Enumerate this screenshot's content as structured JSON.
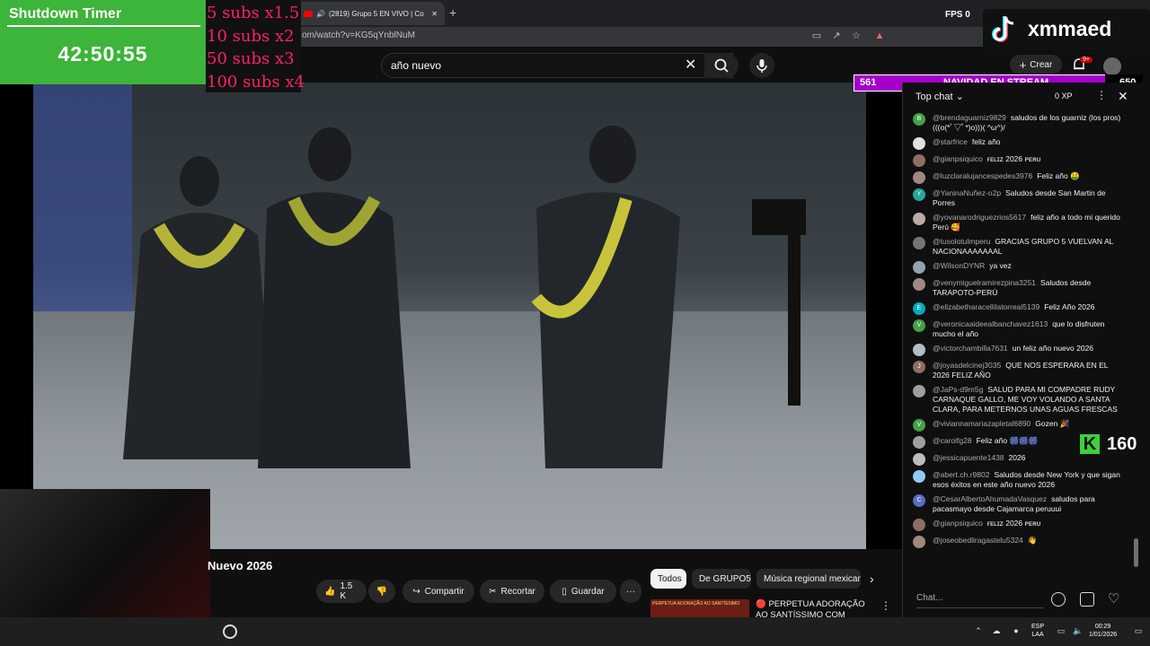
{
  "browser": {
    "tab_title": "(2819) Grupo 5 EN VIVO | Co",
    "new_tab": "+",
    "url": "om/watch?v=KG5qYnblNuM"
  },
  "fps_label": "FPS  0",
  "youtube": {
    "search_value": "año nuevo",
    "clear": "✕",
    "crear_label": "Crear",
    "notif_badge": "9+"
  },
  "overlay": {
    "shutdown_title": "Shutdown Timer",
    "shutdown_time": "42:50:55",
    "subs_lines": [
      "5 subs x1.5",
      "10 subs x2",
      "50 subs x3",
      "100 subs x4"
    ],
    "tiktok_name": "xmmaed",
    "nav_left": "561",
    "nav_mid": "NAVIDAD EN STREAM",
    "nav_right": "650",
    "k_letter": "K",
    "k_count": "160"
  },
  "video": {
    "title": "Nuevo 2026",
    "like_count": "1.5 K",
    "share_label": "Compartir",
    "clip_label": "Recortar",
    "save_label": "Guardar",
    "more_label": "···"
  },
  "chips": [
    "Todos",
    "De GRUPO5",
    "Música regional mexican"
  ],
  "recommendation": {
    "thumb_text": "PERPETUA ADORAÇÃO AO SANTÍSSIMO",
    "title": "🔴 PERPETUA ADORAÇÃO AO SANTÍSSIMO COM FREIRAS"
  },
  "chat": {
    "header": "Top chat",
    "xp": "0 XP",
    "close": "✕",
    "dots": "⋮",
    "input_placeholder": "Chat...",
    "messages": [
      {
        "initial": "B",
        "color": "#43a047",
        "author": "@brendaguarniz9829",
        "text": "saludos de los guarniz (los pros)(((o(*ﾟ▽ﾟ*)o)))( ^ω^)/"
      },
      {
        "initial": "",
        "color": "#e0e0e0",
        "author": "@starfrice",
        "text": "feliz año"
      },
      {
        "initial": "",
        "color": "#8d6e63",
        "author": "@gianpsiquico",
        "text": "ғᴇʟɪᴢ 2026 ᴘᴇʀᴜ"
      },
      {
        "initial": "",
        "color": "#a1887f",
        "author": "@luzclaralujancespedes3976",
        "text": "Feliz año 🤑"
      },
      {
        "initial": "Y",
        "color": "#26a69a",
        "author": "@YaninaNuñez-o2p",
        "text": "Saludos desde San Martin de Porres"
      },
      {
        "initial": "",
        "color": "#bcaaa4",
        "author": "@yovanarodriguezrios5617",
        "text": "feliz año a todo mi querido Perú 🥰"
      },
      {
        "initial": "",
        "color": "#757575",
        "author": "@tusolotulmperu",
        "text": "GRACIAS GRUPO 5 VUELVAN AL NACIONAAAAAAAL"
      },
      {
        "initial": "",
        "color": "#90a4ae",
        "author": "@WilsonDYNR",
        "text": "ya vez"
      },
      {
        "initial": "",
        "color": "#a1887f",
        "author": "@venymiguelramirezpina3251",
        "text": "Saludos desde TARAPOTO-PERÚ"
      },
      {
        "initial": "E",
        "color": "#00acc1",
        "author": "@elizabetharacellilatorreal5139",
        "text": "Feliz Año 2026"
      },
      {
        "initial": "V",
        "color": "#43a047",
        "author": "@veronicaaideealbanchavez1613",
        "text": "que lo disfruten mucho el año"
      },
      {
        "initial": "",
        "color": "#b0bec5",
        "author": "@victorchambilla7631",
        "text": "un feliz año nuevo 2026"
      },
      {
        "initial": "J",
        "color": "#8d6e63",
        "author": "@joyasdelcinej3035",
        "text": "QUE NOS ESPERARA EN EL 2026 FELIZ AÑO"
      },
      {
        "initial": "",
        "color": "#9e9e9e",
        "author": "@JaPs-d9m5g",
        "text": "SALUD PARA MI COMPADRE RUDY CARNAQUE GALLO, ME VOY VOLANDO A SANTA CLARA, PARA METERNOS UNAS AGUAS FRESCAS"
      },
      {
        "initial": "V",
        "color": "#43a047",
        "author": "@viviannamariazapletal6890",
        "text": "Gozen 🎉"
      },
      {
        "initial": "",
        "color": "#9e9e9e",
        "author": "@carolfg28",
        "text": "Feliz año 🎆🎆🎆"
      },
      {
        "initial": "",
        "color": "#bdbdbd",
        "author": "@jessicapuente1438",
        "text": "2026"
      },
      {
        "initial": "",
        "color": "#90caf9",
        "author": "@abert.ch.r9802",
        "text": "Saludos desde New York y que sigan esos éxitos en este año nuevo 2026"
      },
      {
        "initial": "C",
        "color": "#5c6bc0",
        "author": "@CesarAlbertoAhumadaVasquez",
        "text": "saludos para pacasmayo desde Cajamarca peruuui"
      },
      {
        "initial": "",
        "color": "#8d6e63",
        "author": "@gianpsiquico",
        "text": "ғᴇʟɪᴢ 2026 ᴘᴇʀᴜ"
      },
      {
        "initial": "",
        "color": "#a1887f",
        "author": "@joseobedliragastelu5324",
        "text": "👋"
      }
    ]
  },
  "taskbar": {
    "lang_1": "ESP",
    "lang_2": "LAA",
    "time": "00:29",
    "date": "1/01/2026"
  }
}
